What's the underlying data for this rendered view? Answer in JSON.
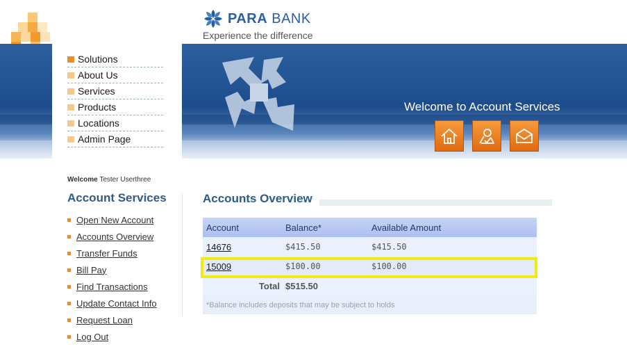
{
  "brand": {
    "name_part1": "PARA",
    "name_part2": "BANK",
    "tagline": "Experience the difference"
  },
  "menu": {
    "items": [
      "Solutions",
      "About Us",
      "Services",
      "Products",
      "Locations",
      "Admin Page"
    ]
  },
  "banner": {
    "title": "Welcome to Account Services",
    "buttons": [
      "home-icon",
      "about-icon",
      "contact-icon"
    ]
  },
  "user": {
    "welcome_label": "Welcome",
    "name": "Tester Userthree"
  },
  "sidebar": {
    "title": "Account Services",
    "links": [
      "Open New Account",
      "Accounts Overview",
      "Transfer Funds",
      "Bill Pay",
      "Find Transactions",
      "Update Contact Info",
      "Request Loan",
      "Log Out"
    ]
  },
  "overview": {
    "title": "Accounts Overview",
    "headers": {
      "account": "Account",
      "balance": "Balance*",
      "available": "Available Amount"
    },
    "rows": [
      {
        "account": "14676",
        "balance": "$415.50",
        "available": "$415.50"
      },
      {
        "account": "15009",
        "balance": "$100.00",
        "available": "$100.00"
      }
    ],
    "total_label": "Total",
    "total_value": "$515.50",
    "footnote": "*Balance includes deposits that may be subject to holds"
  },
  "colors": {
    "accent": "#f08a24",
    "title": "#2e5c86",
    "highlight": "#f2ea10",
    "banner": "#1d4c8c"
  }
}
